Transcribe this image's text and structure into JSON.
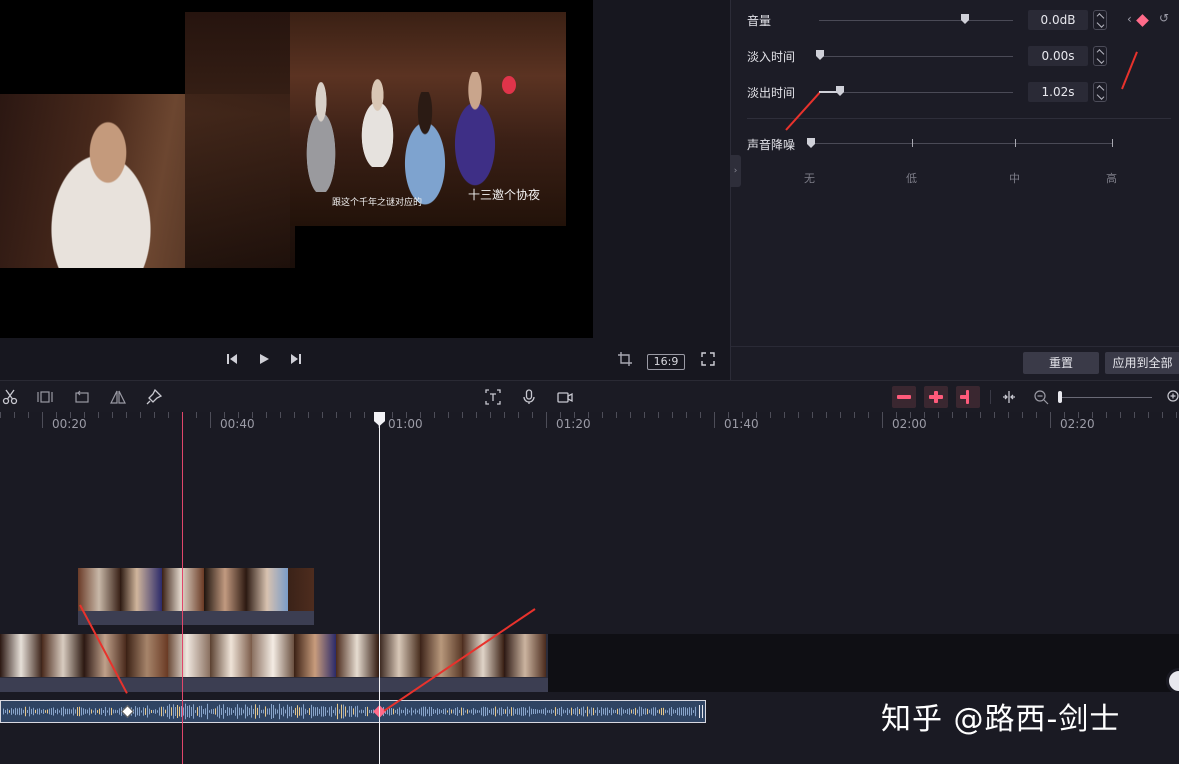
{
  "preview": {
    "subtitle": "跟这个千年之谜对应的",
    "logo_text": "十三邀个协夜"
  },
  "playback": {
    "prev_icon": "prev-frame-icon",
    "play_icon": "play-icon",
    "next_icon": "next-frame-icon",
    "crop_icon": "crop-icon",
    "aspect_ratio": "16:9",
    "fullscreen_icon": "fullscreen-icon"
  },
  "audio_panel": {
    "volume": {
      "label": "音量",
      "value": "0.0dB"
    },
    "fade_in": {
      "label": "淡入时间",
      "value": "0.00s"
    },
    "fade_out": {
      "label": "淡出时间",
      "value": "1.02s"
    },
    "denoise": {
      "label": "声音降噪",
      "levels": [
        "无",
        "低",
        "中",
        "高"
      ]
    },
    "reset_label": "重置",
    "apply_all_label": "应用到全部"
  },
  "toolbar": {
    "left_icons": [
      "split-icon",
      "freeze-icon",
      "reverse-icon",
      "mirror-icon",
      "marker-icon"
    ],
    "center_icons": [
      "text-recognize-icon",
      "microphone-icon",
      "camera-icon"
    ],
    "right_icons": [
      "link-main-track-icon",
      "snap-icon",
      "preview-axis-icon",
      "split-screen-icon",
      "zoom-out-icon",
      "zoom-in-icon"
    ]
  },
  "timeline": {
    "ruler_labels": [
      "00:20",
      "00:40",
      "01:00",
      "01:20",
      "01:40",
      "02:00",
      "02:20"
    ]
  },
  "watermark": "知乎 @路西-剑士",
  "colors": {
    "accent": "#ff5a7a",
    "keyframe": "#ff6b8a",
    "panel_bg": "#1c1c26",
    "annotation_arrow": "#e8322c"
  }
}
